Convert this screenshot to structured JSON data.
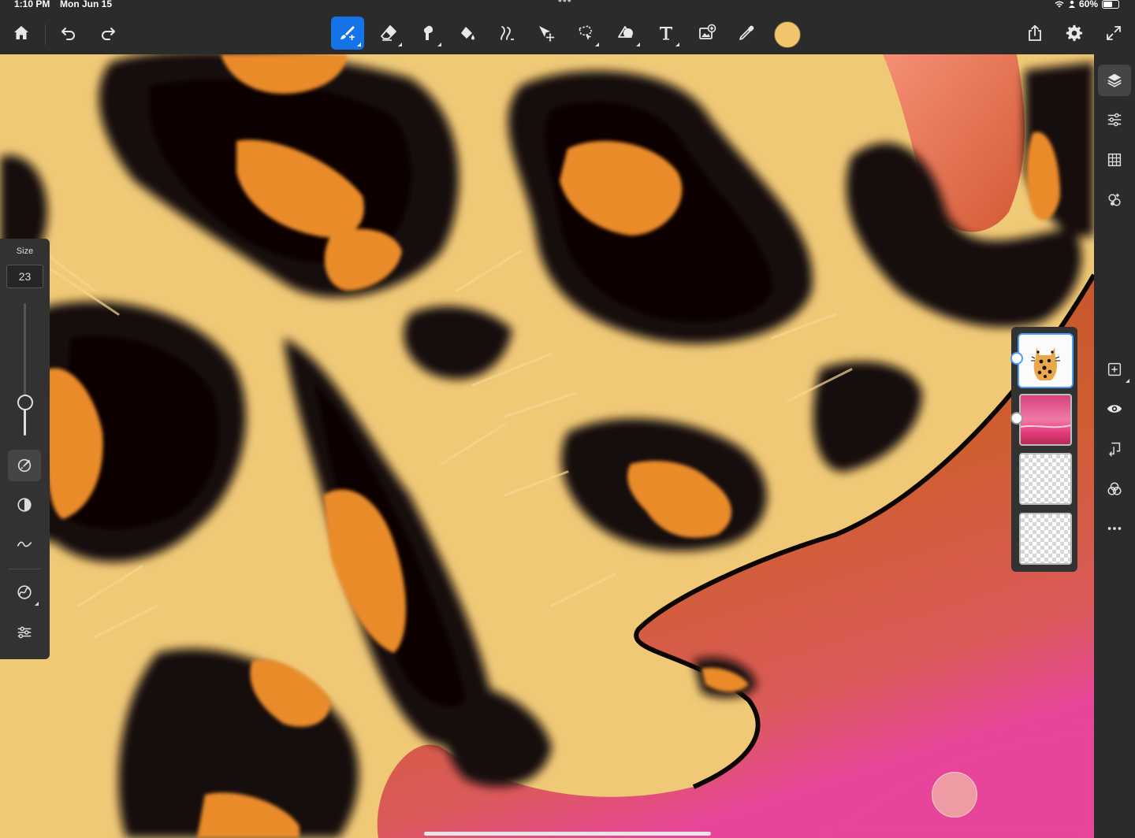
{
  "status_bar": {
    "time": "1:10 PM",
    "date": "Mon Jun 15",
    "battery": "60%",
    "battery_level": 0.6
  },
  "toolbar": {
    "left": [
      {
        "icon": "home-icon"
      },
      {
        "icon": "undo-icon"
      },
      {
        "icon": "redo-icon"
      }
    ],
    "tools": [
      {
        "icon": "paint-brush-icon",
        "active": true
      },
      {
        "icon": "eraser-icon"
      },
      {
        "icon": "smudge-icon"
      },
      {
        "icon": "fill-icon"
      },
      {
        "icon": "liquify-icon"
      },
      {
        "icon": "transform-icon"
      },
      {
        "icon": "lasso-select-icon"
      },
      {
        "icon": "shapes-icon"
      },
      {
        "icon": "text-icon"
      },
      {
        "icon": "add-image-icon"
      },
      {
        "icon": "eyedropper-icon"
      }
    ],
    "current_color": "#f2c46c",
    "right": [
      {
        "icon": "share-icon"
      },
      {
        "icon": "gear-icon"
      },
      {
        "icon": "fullscreen-icon"
      }
    ]
  },
  "brush_panel": {
    "size_label": "Size",
    "size_value": "23",
    "size_fraction": 0.25,
    "buttons": [
      "brush-settings-icon",
      "opacity-icon",
      "smoothing-icon",
      "predictive-stroke-icon",
      "brush-adjustments-icon"
    ]
  },
  "right_rail": {
    "top": [
      "layers-icon",
      "layer-properties-icon",
      "grid-icon",
      "effects-icon"
    ],
    "bottom": [
      "add-layer-icon",
      "visibility-icon",
      "merge-down-icon",
      "blend-mode-icon",
      "more-icon"
    ]
  },
  "layers": [
    {
      "name": "cat-layer",
      "selected": true,
      "thumb": "cat"
    },
    {
      "name": "background-layer",
      "selected": false,
      "thumb": "pink"
    },
    {
      "name": "empty-layer-1",
      "selected": false,
      "thumb": "empty"
    },
    {
      "name": "empty-layer-2",
      "selected": false,
      "thumb": "empty"
    }
  ],
  "colors": {
    "chrome": "#2b2b2b",
    "accent": "#1473e6",
    "fur": "#f0c977",
    "spot_black": "#120909",
    "spot_orange": "#ea8b2c",
    "background_rust": "#c25a2a",
    "background_pink": "#e8459a"
  }
}
